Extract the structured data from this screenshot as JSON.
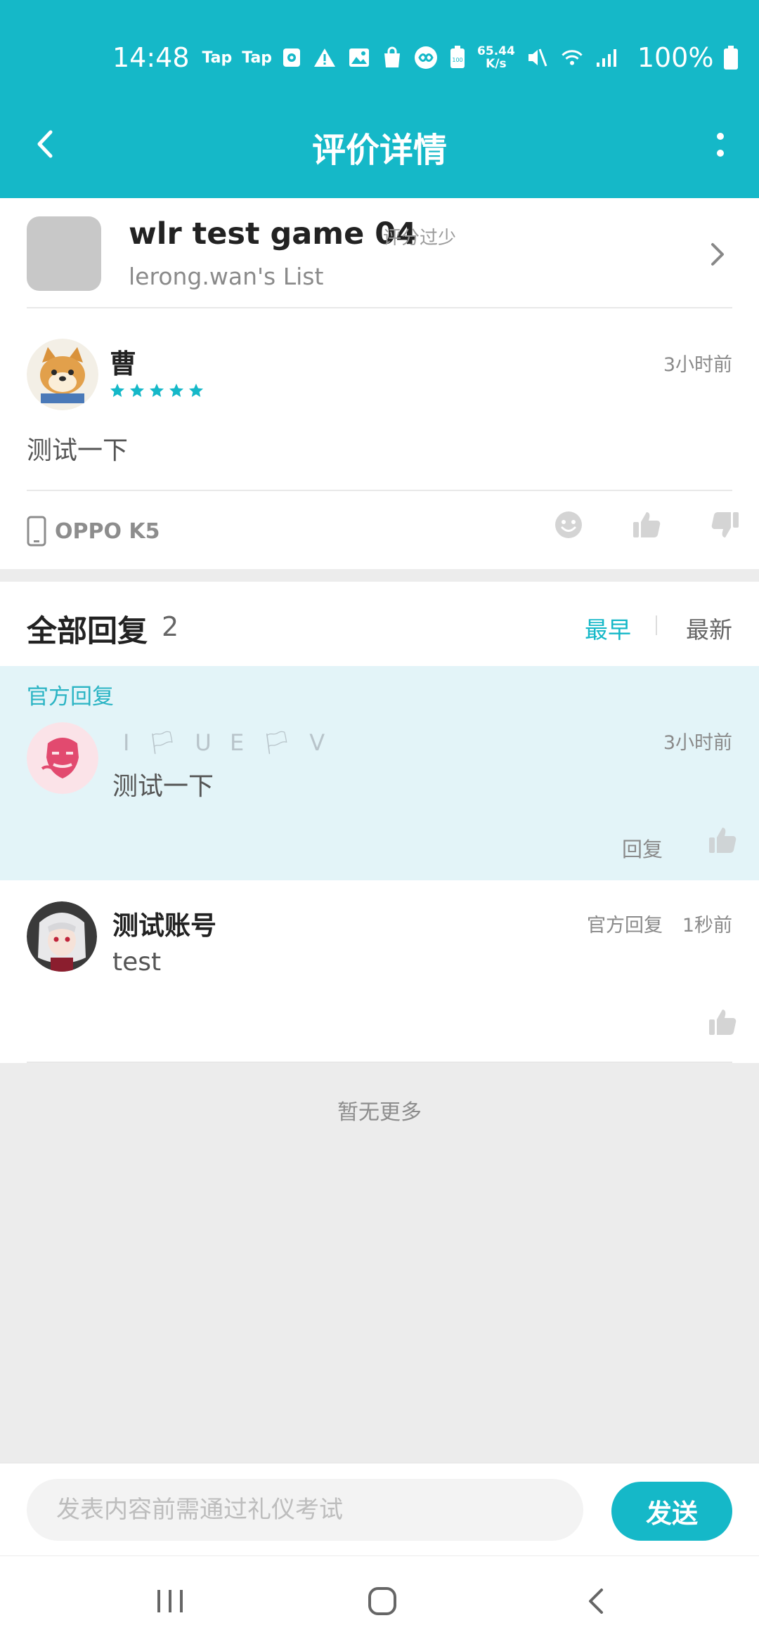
{
  "status_bar": {
    "time": "14:48",
    "notif_1": "Tap",
    "notif_2": "Tap",
    "net_speed_value": "65.44",
    "net_speed_unit": "K/s",
    "battery": "100%",
    "icons": [
      "media-icon",
      "warning-icon",
      "image-icon",
      "shopping-bag-icon",
      "infinity-icon",
      "battery-100-icon",
      "mute-icon",
      "wifi-icon",
      "signal-icon",
      "battery-icon"
    ]
  },
  "header": {
    "title": "评价详情",
    "back_icon": "chevron-left-icon",
    "menu_icon": "more-vertical-icon"
  },
  "game": {
    "title": "wlr test game 04",
    "score_note": "评分过少",
    "subtitle": "lerong.wan's List"
  },
  "review": {
    "author": "曹",
    "rating": 5,
    "time": "3小时前",
    "text": "测试一下",
    "device": "OPPO K5"
  },
  "replies_section": {
    "title": "全部回复",
    "count": "2",
    "sort_options": [
      "最早",
      "最新"
    ],
    "selected_sort": "最早"
  },
  "official_reply": {
    "label": "官方回复",
    "author": "I 🏳 U E 🏳 V",
    "time": "3小时前",
    "text": "测试一下",
    "reply_label": "回复"
  },
  "reply": {
    "author": "测试账号",
    "text": "test",
    "badge": "官方回复",
    "time": "1秒前"
  },
  "footer_note": "暂无更多",
  "composer": {
    "placeholder": "发表内容前需通过礼仪考试",
    "send_label": "发送"
  },
  "colors": {
    "accent": "#15b8c8",
    "official_bg": "#e3f4f8",
    "page_bg": "#ececec"
  }
}
